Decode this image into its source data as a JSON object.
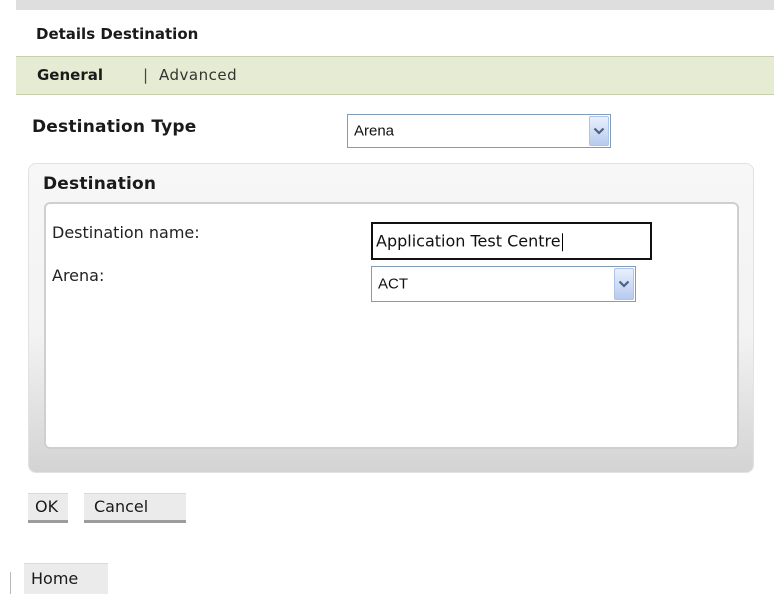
{
  "panel": {
    "title": "Details Destination"
  },
  "tabs": {
    "general": "General",
    "separator": "|",
    "advanced": "Advanced"
  },
  "destination_type": {
    "label": "Destination Type",
    "selected": "Arena"
  },
  "destination_group": {
    "title": "Destination",
    "name_label": "Destination name:",
    "name_value": "Application Test Centre",
    "arena_label": "Arena:",
    "arena_selected": "ACT"
  },
  "buttons": {
    "ok": "OK",
    "cancel": "Cancel",
    "home": "Home"
  },
  "colors": {
    "tab_bar_background": "#e6ecd3",
    "dropdown_button": "#b7cbef"
  },
  "icons": {
    "dropdown": "chevron-down-icon"
  }
}
